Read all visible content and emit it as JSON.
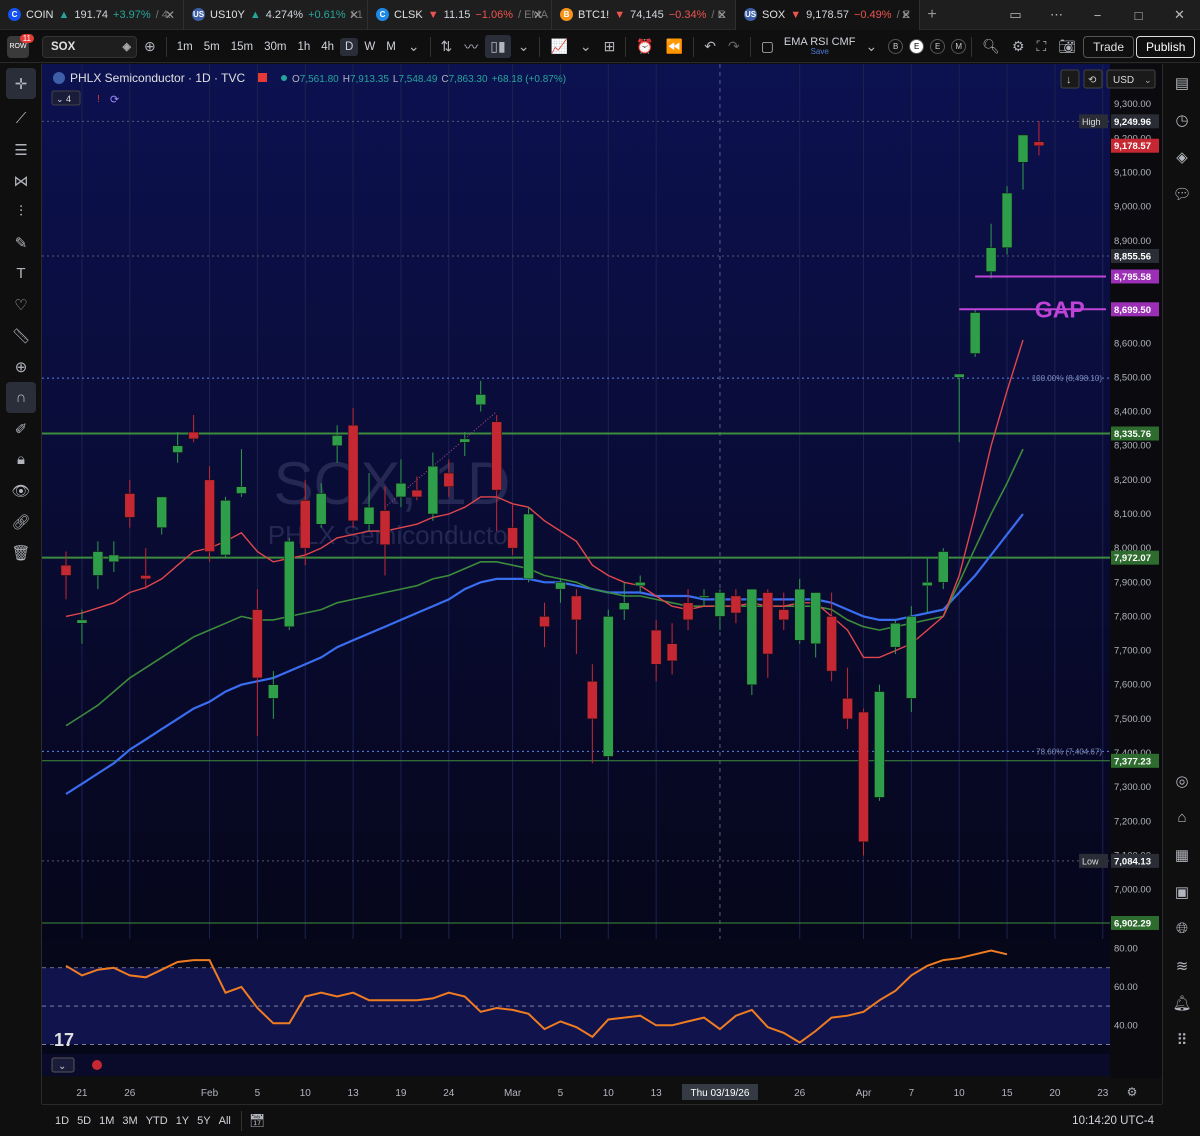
{
  "tabs": [
    {
      "symbol": "COIN",
      "price": "191.74",
      "change": "+3.97%",
      "suffix": "/ 4.",
      "dir": "up",
      "icon": "C",
      "icon_color": "#1652f0"
    },
    {
      "symbol": "US10Y",
      "price": "4.274%",
      "change": "+0.61%",
      "suffix": "/ 1",
      "dir": "up",
      "icon": "US",
      "icon_color": "#3c5fa8"
    },
    {
      "symbol": "CLSK",
      "price": "11.15",
      "change": "−1.06%",
      "suffix": "/ EMA",
      "dir": "dn",
      "icon": "C",
      "icon_color": "#1e88e5"
    },
    {
      "symbol": "BTC1!",
      "price": "74,145",
      "change": "−0.34%",
      "suffix": "/ E",
      "dir": "dn",
      "icon": "B",
      "icon_color": "#f7931a"
    },
    {
      "symbol": "SOX",
      "price": "9,178.57",
      "change": "−0.49%",
      "suffix": "/ E",
      "dir": "dn",
      "icon": "US",
      "icon_color": "#3c5fa8"
    }
  ],
  "toolbar": {
    "notifications": "11",
    "symbol": "SOX",
    "intervals": [
      "1m",
      "5m",
      "15m",
      "30m",
      "1h",
      "4h",
      "D",
      "W",
      "M"
    ],
    "selected_interval": "D",
    "indicators_label": "EMA RSI CMF",
    "indicators_sub": "Save",
    "badges": [
      "B",
      "E",
      "E",
      "M"
    ],
    "trade": "Trade",
    "publish": "Publish"
  },
  "legend": {
    "title": "PHLX Semiconductor · 1D · TVC",
    "ohlc": {
      "o": "7,561.80",
      "h": "7,913.35",
      "l": "7,548.49",
      "c": "7,863.30"
    },
    "change": "+68.18 (+0.87%)",
    "indicator_count": "4",
    "currency": "USD"
  },
  "watermark": {
    "symbol": "SOX, 1D",
    "name": "PHLX Semiconductor"
  },
  "time_axis": {
    "cursor_label": "Thu 03/19/26"
  },
  "bottom": {
    "ranges": [
      "1D",
      "5D",
      "1M",
      "3M",
      "YTD",
      "1Y",
      "5Y",
      "All"
    ],
    "clock": "10:14:20 UTC-4"
  },
  "colors": {
    "up": "#2e9e4a",
    "down": "#c62833",
    "ema_fast": "#e0474c",
    "ema_mid": "#3b8c3b",
    "ema_slow": "#3a6ef0",
    "rsi": "#f07c22",
    "gap": "#c043d8",
    "level": "#3d8c3d"
  },
  "chart_data": {
    "type": "candlestick",
    "price_axis": {
      "min": 6870,
      "max": 9330,
      "ticks": [
        7000,
        7100,
        7200,
        7300,
        7400,
        7500,
        7600,
        7700,
        7800,
        7900,
        8000,
        8100,
        8200,
        8300,
        8400,
        8500,
        8600,
        8700,
        8800,
        8900,
        9000,
        9100,
        9200,
        9300
      ]
    },
    "x_ticks": [
      {
        "i": 1,
        "label": "21"
      },
      {
        "i": 4,
        "label": "26"
      },
      {
        "i": 9,
        "label": "Feb"
      },
      {
        "i": 12,
        "label": "5"
      },
      {
        "i": 15,
        "label": "10"
      },
      {
        "i": 18,
        "label": "13"
      },
      {
        "i": 21,
        "label": "19"
      },
      {
        "i": 24,
        "label": "24"
      },
      {
        "i": 28,
        "label": "Mar"
      },
      {
        "i": 31,
        "label": "5"
      },
      {
        "i": 34,
        "label": "10"
      },
      {
        "i": 37,
        "label": "13"
      },
      {
        "i": 46,
        "label": "26"
      },
      {
        "i": 50,
        "label": "Apr"
      },
      {
        "i": 53,
        "label": "7"
      },
      {
        "i": 56,
        "label": "10"
      },
      {
        "i": 59,
        "label": "15"
      },
      {
        "i": 62,
        "label": "20"
      },
      {
        "i": 65,
        "label": "23"
      }
    ],
    "cursor_index": 41,
    "candles": [
      {
        "o": 7950,
        "h": 7990,
        "l": 7850,
        "c": 7920
      },
      {
        "o": 7780,
        "h": 7820,
        "l": 7720,
        "c": 7790
      },
      {
        "o": 7920,
        "h": 8020,
        "l": 7880,
        "c": 7990
      },
      {
        "o": 7960,
        "h": 8020,
        "l": 7930,
        "c": 7980
      },
      {
        "o": 8160,
        "h": 8200,
        "l": 8060,
        "c": 8090
      },
      {
        "o": 7920,
        "h": 8000,
        "l": 7880,
        "c": 7910
      },
      {
        "o": 8060,
        "h": 8150,
        "l": 8040,
        "c": 8150
      },
      {
        "o": 8280,
        "h": 8340,
        "l": 8250,
        "c": 8300
      },
      {
        "o": 8340,
        "h": 8390,
        "l": 8310,
        "c": 8320
      },
      {
        "o": 8200,
        "h": 8240,
        "l": 7960,
        "c": 7990
      },
      {
        "o": 7980,
        "h": 8150,
        "l": 7970,
        "c": 8140
      },
      {
        "o": 8160,
        "h": 8290,
        "l": 8150,
        "c": 8180
      },
      {
        "o": 7820,
        "h": 7880,
        "l": 7450,
        "c": 7620
      },
      {
        "o": 7560,
        "h": 7640,
        "l": 7500,
        "c": 7600
      },
      {
        "o": 7770,
        "h": 8030,
        "l": 7760,
        "c": 8020
      },
      {
        "o": 8140,
        "h": 8200,
        "l": 7950,
        "c": 8000
      },
      {
        "o": 8070,
        "h": 8190,
        "l": 8060,
        "c": 8160
      },
      {
        "o": 8300,
        "h": 8360,
        "l": 8250,
        "c": 8330
      },
      {
        "o": 8360,
        "h": 8410,
        "l": 8060,
        "c": 8080
      },
      {
        "o": 8070,
        "h": 8220,
        "l": 8050,
        "c": 8120
      },
      {
        "o": 8110,
        "h": 8180,
        "l": 7920,
        "c": 8010
      },
      {
        "o": 8150,
        "h": 8260,
        "l": 8120,
        "c": 8190
      },
      {
        "o": 8170,
        "h": 8210,
        "l": 8140,
        "c": 8150
      },
      {
        "o": 8100,
        "h": 8280,
        "l": 8080,
        "c": 8240
      },
      {
        "o": 8220,
        "h": 8260,
        "l": 8150,
        "c": 8180
      },
      {
        "o": 8310,
        "h": 8340,
        "l": 8270,
        "c": 8320
      },
      {
        "o": 8420,
        "h": 8490,
        "l": 8400,
        "c": 8450
      },
      {
        "o": 8370,
        "h": 8390,
        "l": 8050,
        "c": 8170
      },
      {
        "o": 8060,
        "h": 8130,
        "l": 7980,
        "c": 8000
      },
      {
        "o": 7910,
        "h": 8120,
        "l": 7900,
        "c": 8100
      },
      {
        "o": 7800,
        "h": 7840,
        "l": 7710,
        "c": 7770
      },
      {
        "o": 7880,
        "h": 7910,
        "l": 7840,
        "c": 7900
      },
      {
        "o": 7860,
        "h": 7880,
        "l": 7690,
        "c": 7790
      },
      {
        "o": 7610,
        "h": 7660,
        "l": 7370,
        "c": 7500
      },
      {
        "o": 7390,
        "h": 7820,
        "l": 7380,
        "c": 7800
      },
      {
        "o": 7820,
        "h": 7900,
        "l": 7790,
        "c": 7840
      },
      {
        "o": 7890,
        "h": 7920,
        "l": 7870,
        "c": 7900
      },
      {
        "o": 7760,
        "h": 7790,
        "l": 7610,
        "c": 7660
      },
      {
        "o": 7720,
        "h": 7780,
        "l": 7630,
        "c": 7670
      },
      {
        "o": 7840,
        "h": 7880,
        "l": 7760,
        "c": 7790
      },
      {
        "o": 7860,
        "h": 7880,
        "l": 7830,
        "c": 7860
      },
      {
        "o": 7800,
        "h": 7880,
        "l": 7760,
        "c": 7870
      },
      {
        "o": 7860,
        "h": 7880,
        "l": 7780,
        "c": 7810
      },
      {
        "o": 7600,
        "h": 7880,
        "l": 7570,
        "c": 7880
      },
      {
        "o": 7870,
        "h": 7880,
        "l": 7620,
        "c": 7690
      },
      {
        "o": 7820,
        "h": 7870,
        "l": 7760,
        "c": 7790
      },
      {
        "o": 7730,
        "h": 7910,
        "l": 7720,
        "c": 7880
      },
      {
        "o": 7720,
        "h": 7850,
        "l": 7680,
        "c": 7870
      },
      {
        "o": 7800,
        "h": 7870,
        "l": 7610,
        "c": 7640
      },
      {
        "o": 7560,
        "h": 7650,
        "l": 7470,
        "c": 7500
      },
      {
        "o": 7520,
        "h": 7530,
        "l": 7100,
        "c": 7140
      },
      {
        "o": 7270,
        "h": 7600,
        "l": 7260,
        "c": 7580
      },
      {
        "o": 7710,
        "h": 7790,
        "l": 7690,
        "c": 7780
      },
      {
        "o": 7560,
        "h": 7830,
        "l": 7520,
        "c": 7800
      },
      {
        "o": 7890,
        "h": 7970,
        "l": 7810,
        "c": 7900
      },
      {
        "o": 7900,
        "h": 8000,
        "l": 7880,
        "c": 7990
      },
      {
        "o": 8500,
        "h": 8500,
        "l": 8310,
        "c": 8510
      },
      {
        "o": 8570,
        "h": 8700,
        "l": 8560,
        "c": 8690
      },
      {
        "o": 8810,
        "h": 8950,
        "l": 8790,
        "c": 8880
      },
      {
        "o": 8880,
        "h": 9060,
        "l": 8860,
        "c": 9040
      },
      {
        "o": 9130,
        "h": 9210,
        "l": 9050,
        "c": 9210
      },
      {
        "o": 9190,
        "h": 9250,
        "l": 9150,
        "c": 9178.57
      }
    ],
    "ema_fast": [
      7800,
      7810,
      7825,
      7840,
      7870,
      7885,
      7910,
      7950,
      7990,
      8000,
      8020,
      8045,
      7990,
      7960,
      7970,
      7980,
      8000,
      8030,
      8040,
      8050,
      8050,
      8060,
      8070,
      8090,
      8100,
      8120,
      8150,
      8150,
      8130,
      8120,
      8080,
      8050,
      8020,
      7950,
      7920,
      7900,
      7890,
      7860,
      7830,
      7820,
      7830,
      7830,
      7830,
      7840,
      7830,
      7830,
      7840,
      7840,
      7800,
      7760,
      7680,
      7680,
      7700,
      7720,
      7760,
      7800,
      7920,
      8100,
      8300,
      8460,
      8610
    ],
    "ema_mid": [
      7480,
      7510,
      7540,
      7580,
      7620,
      7650,
      7680,
      7710,
      7740,
      7760,
      7780,
      7800,
      7790,
      7790,
      7800,
      7810,
      7820,
      7840,
      7850,
      7860,
      7870,
      7880,
      7890,
      7910,
      7920,
      7940,
      7960,
      7960,
      7950,
      7940,
      7920,
      7910,
      7900,
      7880,
      7870,
      7860,
      7860,
      7850,
      7840,
      7830,
      7830,
      7830,
      7830,
      7830,
      7830,
      7830,
      7830,
      7830,
      7820,
      7790,
      7770,
      7760,
      7770,
      7780,
      7790,
      7800,
      7900,
      8000,
      8100,
      8190,
      8290
    ],
    "ema_slow": [
      7280,
      7310,
      7340,
      7370,
      7410,
      7440,
      7470,
      7500,
      7530,
      7550,
      7580,
      7600,
      7610,
      7620,
      7640,
      7660,
      7680,
      7710,
      7730,
      7750,
      7770,
      7790,
      7810,
      7830,
      7850,
      7880,
      7900,
      7910,
      7910,
      7910,
      7900,
      7900,
      7890,
      7880,
      7870,
      7870,
      7870,
      7860,
      7860,
      7860,
      7850,
      7850,
      7850,
      7850,
      7850,
      7850,
      7850,
      7850,
      7840,
      7820,
      7800,
      7790,
      7790,
      7800,
      7810,
      7820,
      7870,
      7920,
      7980,
      8040,
      8100
    ],
    "horizontal_levels": [
      {
        "price": 8335.76,
        "label": "8,335.76",
        "color": "#3d8c3d",
        "style": "solid"
      },
      {
        "price": 7972.07,
        "label": "7,972.07",
        "color": "#3d8c3d",
        "style": "solid"
      }
    ],
    "dotted_levels": [
      {
        "price": 8498.1,
        "label": "100.00% (8,498.10)"
      },
      {
        "price": 7404.67,
        "label": "78.60% (7,404.67)"
      }
    ],
    "gap_lines": [
      {
        "price": 8795.58,
        "label": "8,795.58"
      },
      {
        "price": 8699.5,
        "label": "8,699.50"
      }
    ],
    "gap_text": "GAP",
    "price_labels": [
      {
        "price": 9249.96,
        "tag": "High",
        "label": "9,249.96",
        "kind": "dark"
      },
      {
        "price": 9178.57,
        "label": "9,178.57",
        "kind": "red"
      },
      {
        "price": 8855.56,
        "label": "8,855.56",
        "kind": "dark"
      },
      {
        "price": 8795.58,
        "label": "8,795.58",
        "kind": "gap"
      },
      {
        "price": 8699.5,
        "label": "8,699.50",
        "kind": "gap"
      },
      {
        "price": 8335.76,
        "label": "8,335.76",
        "kind": "green"
      },
      {
        "price": 7972.07,
        "label": "7,972.07",
        "kind": "green"
      },
      {
        "price": 7377.23,
        "label": "7,377.23",
        "kind": "green"
      },
      {
        "price": 7084.13,
        "tag": "Low",
        "label": "7,084.13",
        "kind": "dark"
      },
      {
        "price": 6902.29,
        "label": "6,902.29",
        "kind": "green"
      }
    ],
    "rsi": {
      "ticks": [
        40,
        60,
        80
      ],
      "bands": [
        30,
        50,
        70
      ],
      "min": 25,
      "max": 85,
      "values": [
        71,
        66,
        69,
        70,
        66,
        65,
        69,
        73,
        74,
        74,
        57,
        60,
        49,
        41,
        41,
        55,
        57,
        55,
        57,
        53,
        53,
        53,
        53,
        54,
        57,
        55,
        47,
        49,
        48,
        46,
        38,
        42,
        39,
        34,
        43,
        44,
        45,
        40,
        40,
        42,
        44,
        38,
        45,
        48,
        39,
        36,
        31,
        37,
        44,
        45,
        47,
        53,
        58,
        66,
        71,
        74,
        75,
        77,
        79,
        77
      ]
    }
  }
}
